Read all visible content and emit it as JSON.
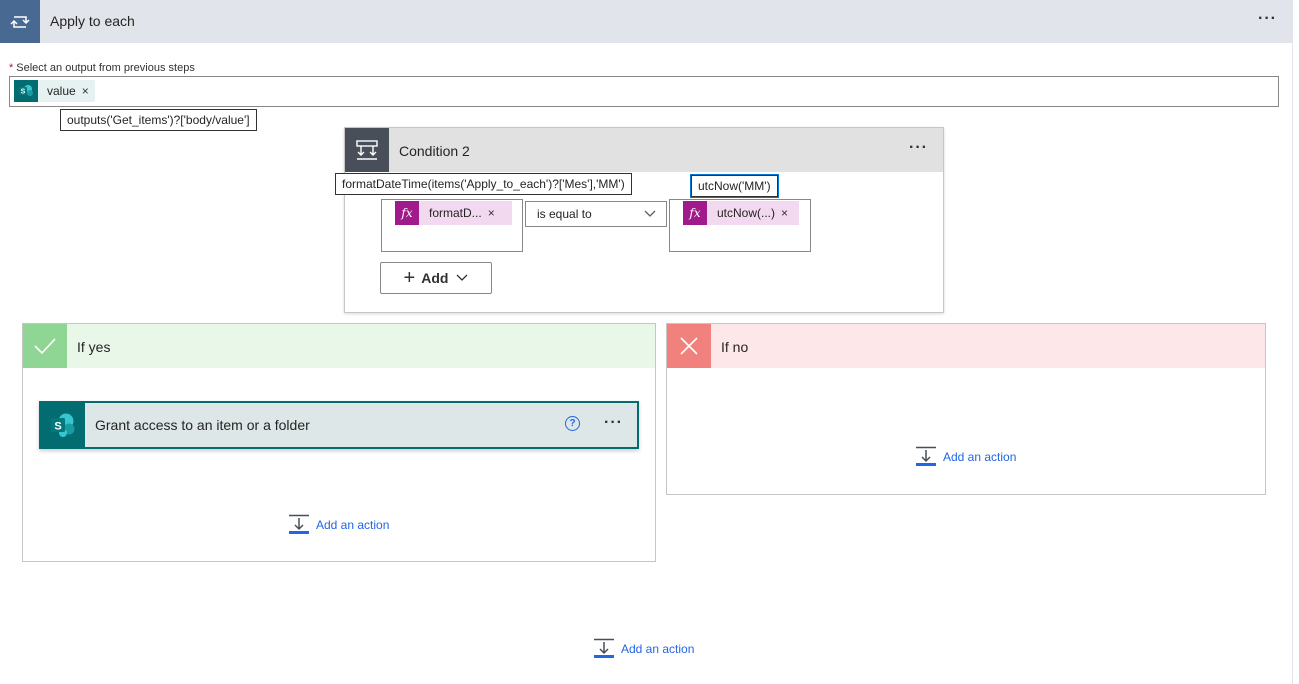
{
  "apply_to_each": {
    "title": "Apply to each",
    "select_label": "Select an output from previous steps",
    "required_mark": "*",
    "value_token": "value",
    "value_tooltip": "outputs('Get_items')?['body/value']"
  },
  "condition": {
    "title": "Condition 2",
    "left_token": "formatD...",
    "left_tooltip": "formatDateTime(items('Apply_to_each')?['Mes'],'MM')",
    "operator": "is equal to",
    "right_token": "utcNow(...)",
    "right_tooltip": "utcNow('MM')",
    "add_label": "Add"
  },
  "if_yes": {
    "title": "If yes",
    "action_title": "Grant access to an item or a folder",
    "add_action": "Add an action"
  },
  "if_no": {
    "title": "If no",
    "add_action": "Add an action"
  },
  "footer": {
    "add_action": "Add an action"
  },
  "colors": {
    "loop_accent": "#486991",
    "condition_accent": "#484f58",
    "yes_accent": "#8fd694",
    "no_accent": "#f1817d",
    "sharepoint": "#036c70",
    "expression": "#a01a8b",
    "link": "#2266e3"
  },
  "icons": {
    "loop": "loop-icon",
    "condition": "condition-icon",
    "sharepoint": "sharepoint-icon",
    "expression": "fx-icon",
    "check": "check-icon",
    "close": "close-icon",
    "help": "help-icon",
    "add_action": "add-action-icon"
  }
}
